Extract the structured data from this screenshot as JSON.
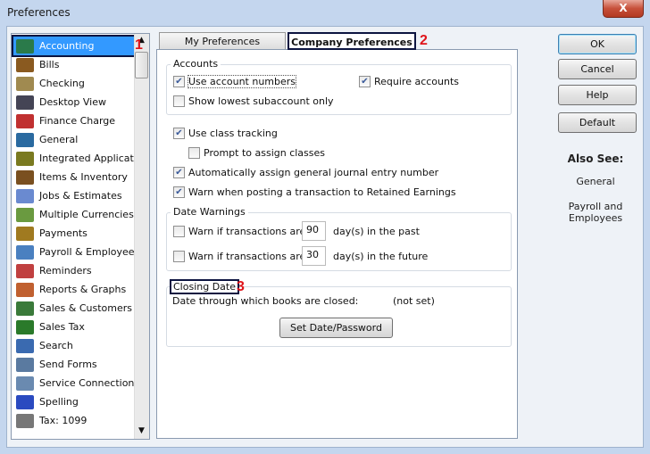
{
  "window": {
    "title": "Preferences",
    "close_label": "X"
  },
  "sidebar": {
    "items": [
      {
        "label": "Accounting",
        "icon": "accounting-icon",
        "color": "#2a7a4a",
        "selected": true
      },
      {
        "label": "Bills",
        "icon": "bills-icon",
        "color": "#8a5a20"
      },
      {
        "label": "Checking",
        "icon": "checking-icon",
        "color": "#a08a50"
      },
      {
        "label": "Desktop View",
        "icon": "desktop-view-icon",
        "color": "#445"
      },
      {
        "label": "Finance Charge",
        "icon": "finance-charge-icon",
        "color": "#c03030"
      },
      {
        "label": "General",
        "icon": "general-icon",
        "color": "#2a6aa0"
      },
      {
        "label": "Integrated Applicatio",
        "icon": "integrated-applications-icon",
        "color": "#7a7a20"
      },
      {
        "label": "Items & Inventory",
        "icon": "items-inventory-icon",
        "color": "#7a5020"
      },
      {
        "label": "Jobs & Estimates",
        "icon": "jobs-estimates-icon",
        "color": "#6a8ad0"
      },
      {
        "label": "Multiple Currencies",
        "icon": "multiple-currencies-icon",
        "color": "#6a9a40"
      },
      {
        "label": "Payments",
        "icon": "payments-icon",
        "color": "#a07a20"
      },
      {
        "label": "Payroll & Employees",
        "icon": "payroll-employees-icon",
        "color": "#4a80c0"
      },
      {
        "label": "Reminders",
        "icon": "reminders-icon",
        "color": "#c04040"
      },
      {
        "label": "Reports & Graphs",
        "icon": "reports-graphs-icon",
        "color": "#c06030"
      },
      {
        "label": "Sales & Customers",
        "icon": "sales-customers-icon",
        "color": "#3a7a3a"
      },
      {
        "label": "Sales Tax",
        "icon": "sales-tax-icon",
        "color": "#2a7a2a"
      },
      {
        "label": "Search",
        "icon": "search-icon",
        "color": "#3a6ab0"
      },
      {
        "label": "Send Forms",
        "icon": "send-forms-icon",
        "color": "#5a7aa0"
      },
      {
        "label": "Service Connection",
        "icon": "service-connection-icon",
        "color": "#6a8ab0"
      },
      {
        "label": "Spelling",
        "icon": "spelling-icon",
        "color": "#2a4ac0"
      },
      {
        "label": "Tax: 1099",
        "icon": "tax-1099-icon",
        "color": "#777"
      }
    ],
    "selection_color": "#3399ff"
  },
  "annotations": {
    "one": "1",
    "two": "2",
    "three": "3",
    "color": "#e0141a"
  },
  "tabs": [
    {
      "label": "My Preferences",
      "active": false
    },
    {
      "label": "Company Preferences",
      "active": true
    }
  ],
  "accounts": {
    "label": "Accounts",
    "use_account_numbers": {
      "label": "Use account numbers",
      "checked": true
    },
    "require_accounts": {
      "label": "Require accounts",
      "checked": true
    },
    "show_lowest": {
      "label": "Show lowest subaccount only",
      "checked": false
    }
  },
  "options": {
    "class_tracking": {
      "label": "Use class tracking",
      "checked": true
    },
    "prompt_classes": {
      "label": "Prompt to assign classes",
      "checked": false
    },
    "auto_journal": {
      "label": "Automatically assign general journal entry number",
      "checked": true
    },
    "warn_retained": {
      "label": "Warn when posting a transaction to Retained Earnings",
      "checked": true
    }
  },
  "date_warnings": {
    "label": "Date Warnings",
    "past": {
      "prefix": "Warn if transactions are",
      "value": "90",
      "suffix": "day(s) in the past",
      "checked": false
    },
    "future": {
      "prefix": "Warn if transactions are",
      "value": "30",
      "suffix": "day(s) in the future",
      "checked": false
    }
  },
  "closing_date": {
    "label": "Closing Date",
    "text": "Date through which books are closed:",
    "value": "(not set)",
    "button": "Set Date/Password"
  },
  "buttons": {
    "ok": "OK",
    "cancel": "Cancel",
    "help": "Help",
    "default": "Default"
  },
  "also_see": {
    "title": "Also See:",
    "links": [
      "General",
      "Payroll and",
      "Employees"
    ]
  }
}
